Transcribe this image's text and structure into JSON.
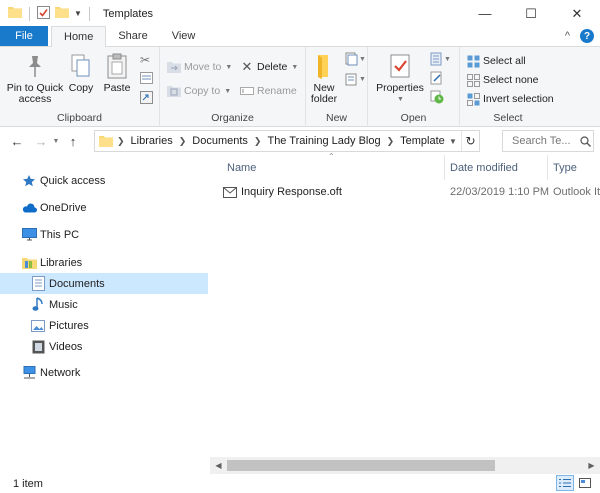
{
  "window": {
    "title": "Templates",
    "minimize_glyph": "—",
    "maximize_glyph": "☐",
    "close_glyph": "✕"
  },
  "tabs": {
    "file": "File",
    "home": "Home",
    "share": "Share",
    "view": "View",
    "expand_glyph": "^",
    "help_glyph": "?"
  },
  "ribbon": {
    "clipboard": {
      "label": "Clipboard",
      "pin": "Pin to Quick access",
      "copy": "Copy",
      "paste": "Paste"
    },
    "organize": {
      "label": "Organize",
      "move_to": "Move to",
      "copy_to": "Copy to",
      "delete": "Delete",
      "rename": "Rename"
    },
    "new": {
      "label": "New",
      "new_folder": "New folder"
    },
    "open": {
      "label": "Open",
      "properties": "Properties"
    },
    "select": {
      "label": "Select",
      "select_all": "Select all",
      "select_none": "Select none",
      "invert": "Invert selection"
    }
  },
  "address": {
    "crumbs": [
      "Libraries",
      "Documents",
      "The Training Lady Blog",
      "Templates"
    ],
    "search_placeholder": "Search Te..."
  },
  "navpane": {
    "quick_access": "Quick access",
    "onedrive": "OneDrive",
    "this_pc": "This PC",
    "libraries": "Libraries",
    "documents": "Documents",
    "music": "Music",
    "pictures": "Pictures",
    "videos": "Videos",
    "network": "Network"
  },
  "columns": {
    "name": "Name",
    "date_modified": "Date modified",
    "type": "Type"
  },
  "files": [
    {
      "name": "Inquiry Response.oft",
      "date": "22/03/2019 1:10 PM",
      "type": "Outlook It"
    }
  ],
  "status": {
    "item_count": "1 item"
  },
  "colors": {
    "accent": "#1979ca",
    "selected": "#cce8ff",
    "ribbon_bg": "#f5f6f7"
  }
}
